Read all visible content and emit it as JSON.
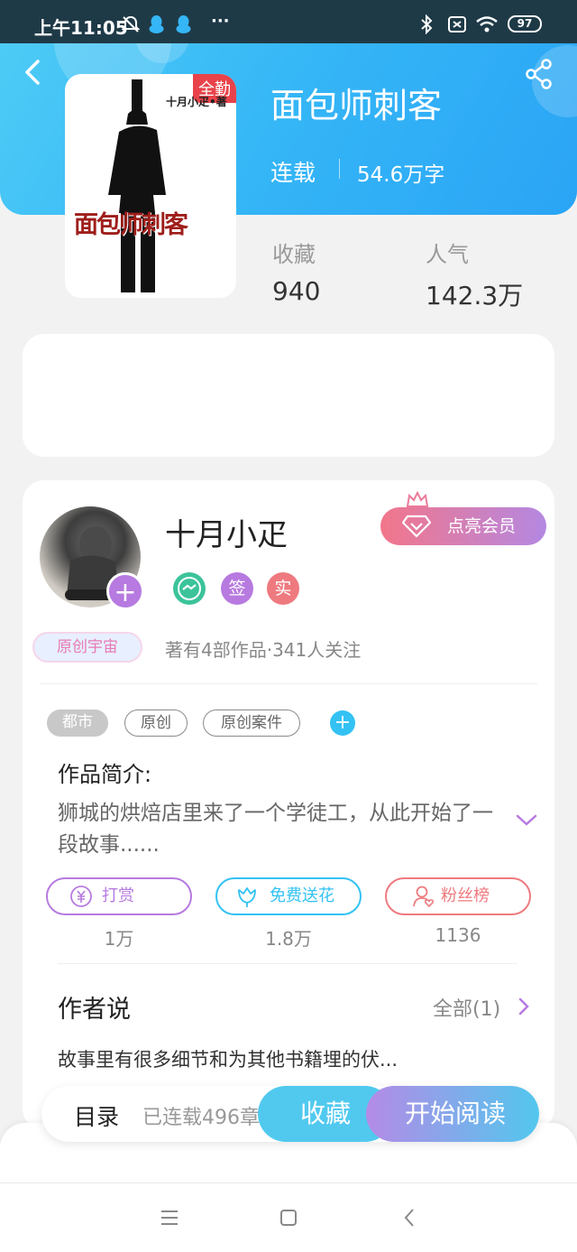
{
  "status_bar": {
    "time": "上午11:05",
    "battery": "97",
    "more": "···"
  },
  "book": {
    "title": "面包师刺客",
    "status": "连载",
    "word_count": "54.6万字",
    "cover_title": "面包师刺客",
    "cover_author": "十月小疋•著",
    "cover_badge": "全勤"
  },
  "stats": [
    {
      "label": "收藏",
      "value": "940"
    },
    {
      "label": "人气",
      "value": "142.3万"
    }
  ],
  "author": {
    "name": "十月小疋",
    "vip_label": "点亮会员",
    "badges": [
      "签",
      "实"
    ],
    "universe_tag": "原创宇宙",
    "info": "著有4部作品·341人关注"
  },
  "tags": [
    "都市",
    "原创",
    "原创案件"
  ],
  "intro": {
    "title": "作品简介:",
    "text": "狮城的烘焙店里来了一个学徒工，从此开始了一段故事......"
  },
  "actions": [
    {
      "label": "打赏",
      "count": "1万",
      "color": "#b77ae0"
    },
    {
      "label": "免费送花",
      "count": "1.8万",
      "color": "#33c2f3"
    },
    {
      "label": "粉丝榜",
      "count": "1136",
      "color": "#ee7a7f"
    }
  ],
  "author_says": {
    "title": "作者说",
    "all_label": "全部(1)",
    "text": "故事里有很多细节和为其他书籍埋的伏..."
  },
  "bottom_bar": {
    "toc_label": "目录",
    "toc_count": "已连载496章",
    "fav_label": "收藏",
    "read_label": "开始阅读"
  }
}
